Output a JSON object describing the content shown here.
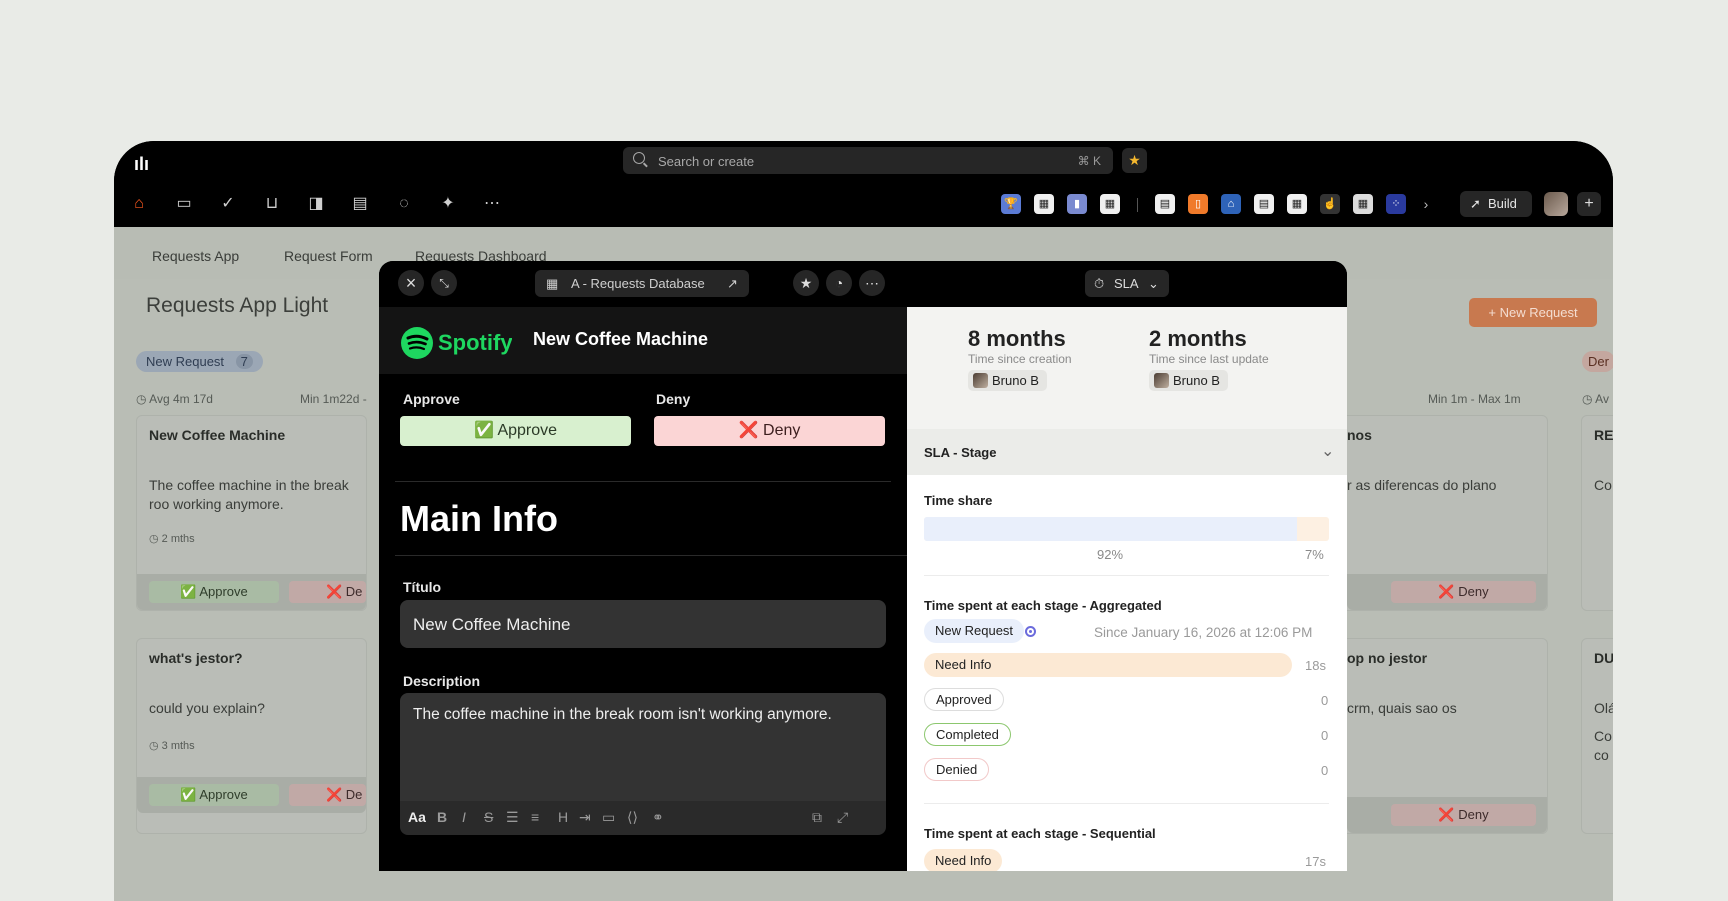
{
  "topbar": {
    "logo": "ılı",
    "search_placeholder": "Search or create",
    "search_shortcut": "⌘ K",
    "build_label": "Build"
  },
  "background": {
    "tabs": [
      "Requests App",
      "Request Form",
      "Requests Dashboard"
    ],
    "page_title": "Requests App Light",
    "new_request_button": "+ New Request",
    "column1": {
      "status": "New Request",
      "count": "7",
      "avg": "Avg 4m 17d",
      "min": "Min 1m22d -",
      "cards": [
        {
          "title": "New Coffee Machine",
          "text": "The coffee machine in the break roo working anymore.",
          "age": "2 mths",
          "approve": "✅ Approve",
          "deny": "❌ De"
        },
        {
          "title": "what's jestor?",
          "text": "could you explain?",
          "age": "3 mths",
          "approve": "✅ Approve",
          "deny": "❌ De"
        }
      ]
    },
    "column2": {
      "minmax": "Min 1m - Max 1m",
      "card1_title": "nos",
      "card1_text": "r as diferencas do plano",
      "card1_deny": "❌ Deny",
      "card2_title": "op no jestor",
      "card2_text": "crm, quais sao os",
      "card2_deny": "❌ Deny"
    },
    "column3": {
      "status": "Der",
      "avg": "Av",
      "card1_title": "RE",
      "card1_text": "Co",
      "card2_title": "DU",
      "card2_text_a": "Olá",
      "card2_text_b": "Co co"
    }
  },
  "modal": {
    "database_label": "A - Requests Database",
    "sla_label": "SLA",
    "brand": "Spotify",
    "record_title": "New Coffee Machine",
    "approve_label": "Approve",
    "approve_button": "✅ Approve",
    "deny_label": "Deny",
    "deny_button": "❌ Deny",
    "section_title": "Main Info",
    "titulo_label": "Título",
    "titulo_value": "New Coffee Machine",
    "description_label": "Description",
    "description_value": "The coffee machine in the break room isn't working anymore.",
    "toolbar_aa": "Aa",
    "sla": {
      "creation_value": "8 months",
      "creation_label": "Time since creation",
      "creation_user": "Bruno B",
      "update_value": "2 months",
      "update_label": "Time since last update",
      "update_user": "Bruno B",
      "stage_header": "SLA - Stage",
      "time_share_label": "Time share",
      "time_share": [
        {
          "pct_label": "92%",
          "fraction": 0.92
        },
        {
          "pct_label": "7%",
          "fraction": 0.07
        }
      ],
      "aggregated_title": "Time spent at each stage - Aggregated",
      "current_stage": "New Request",
      "current_since": "Since January 16, 2026 at 12:06 PM",
      "stages": [
        {
          "name": "Need Info",
          "value": "18s"
        },
        {
          "name": "Approved",
          "value": "0"
        },
        {
          "name": "Completed",
          "value": "0"
        },
        {
          "name": "Denied",
          "value": "0"
        }
      ],
      "sequential_title": "Time spent at each stage - Sequential",
      "sequential_first": "Need Info",
      "sequential_first_value": "17s"
    }
  }
}
